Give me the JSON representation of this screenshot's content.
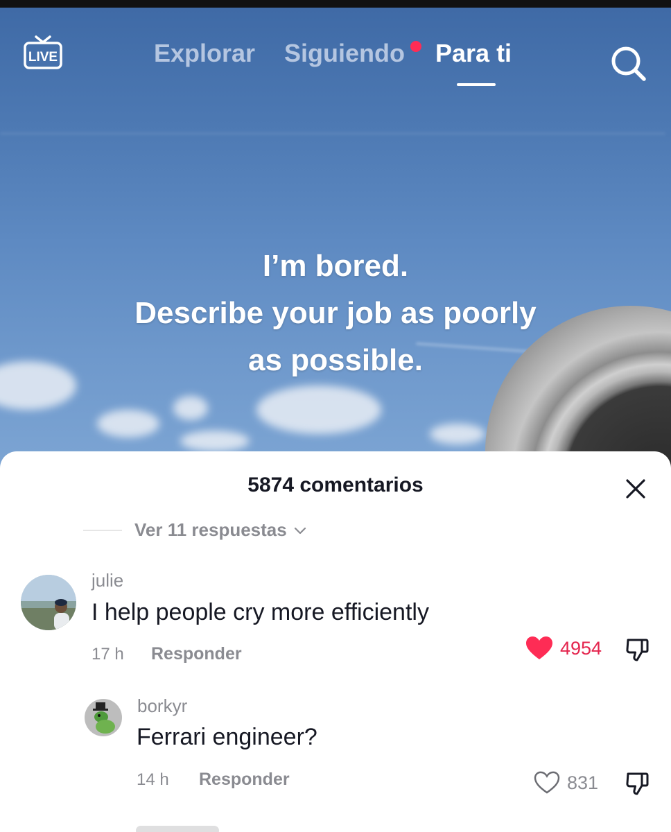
{
  "nav": {
    "live_label": "LIVE",
    "tabs": [
      {
        "label": "Explorar",
        "active": false
      },
      {
        "label": "Siguiendo",
        "active": false,
        "has_notification_dot": true
      },
      {
        "label": "Para ti",
        "active": true
      }
    ],
    "accent_color": "#fe2c55"
  },
  "video": {
    "caption_lines": [
      "I’m bored.",
      "Describe your job as poorly",
      "as possible."
    ]
  },
  "comments_sheet": {
    "title": "5874 comentarios",
    "view_replies": "Ver 11 respuestas",
    "comments": [
      {
        "username": "julie",
        "text": "I help people cry more efficiently",
        "time": "17 h",
        "reply_label": "Responder",
        "likes": "4954",
        "liked": true
      },
      {
        "username": "borkyr",
        "text": "Ferrari engineer?",
        "time": "14 h",
        "reply_label": "Responder",
        "likes": "831",
        "liked": false
      }
    ]
  }
}
